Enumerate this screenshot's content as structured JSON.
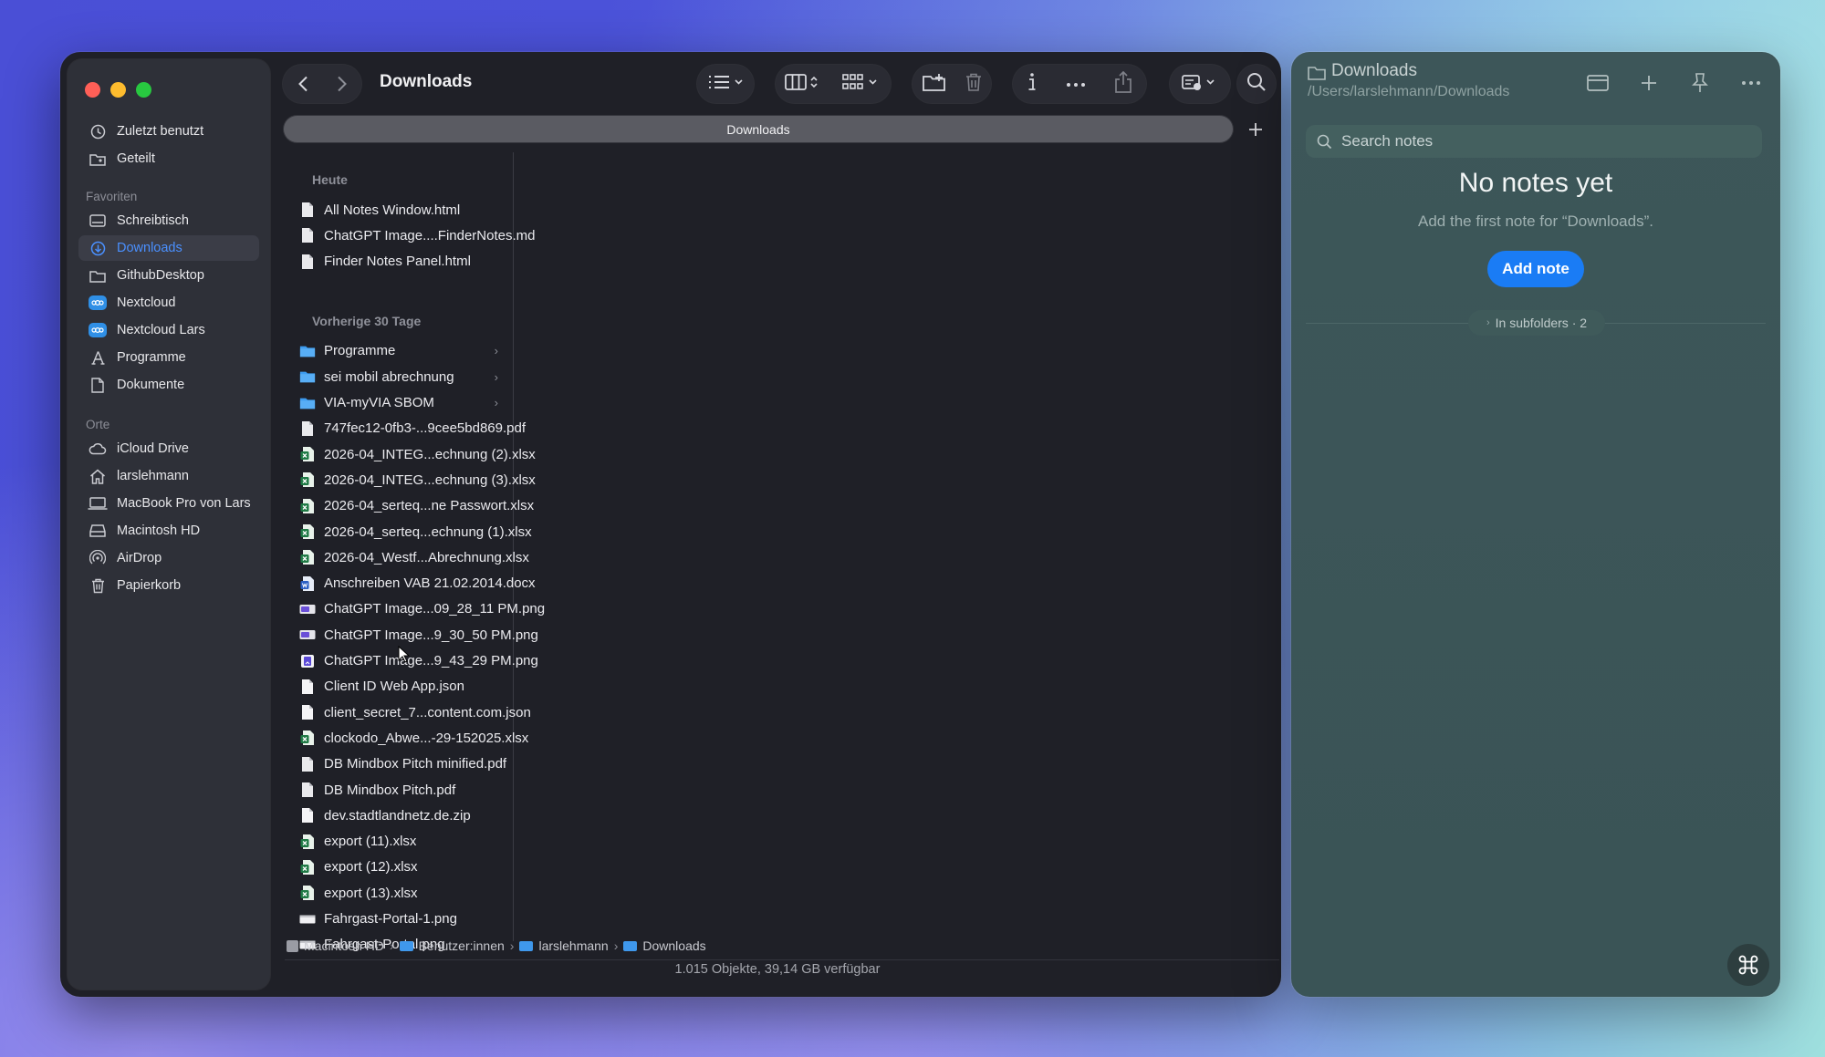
{
  "finder": {
    "title": "Downloads",
    "tab_label": "Downloads",
    "sidebar": {
      "recents": [
        {
          "label": "Zuletzt benutzt",
          "icon": "clock-icon"
        },
        {
          "label": "Geteilt",
          "icon": "shared-folder-icon"
        }
      ],
      "favorites_header": "Favoriten",
      "favorites": [
        {
          "label": "Schreibtisch",
          "icon": "desktop-icon"
        },
        {
          "label": "Downloads",
          "icon": "download-icon",
          "active": true
        },
        {
          "label": "GithubDesktop",
          "icon": "folder-icon"
        },
        {
          "label": "Nextcloud",
          "icon": "nextcloud-icon"
        },
        {
          "label": "Nextcloud Lars",
          "icon": "nextcloud-icon"
        },
        {
          "label": "Programme",
          "icon": "applications-icon"
        },
        {
          "label": "Dokumente",
          "icon": "document-icon"
        }
      ],
      "places_header": "Orte",
      "places": [
        {
          "label": "iCloud Drive",
          "icon": "cloud-icon"
        },
        {
          "label": "larslehmann",
          "icon": "home-icon"
        },
        {
          "label": "MacBook Pro von Lars",
          "icon": "laptop-icon"
        },
        {
          "label": "Macintosh HD",
          "icon": "disk-icon"
        },
        {
          "label": "AirDrop",
          "icon": "airdrop-icon"
        },
        {
          "label": "Papierkorb",
          "icon": "trash-icon"
        }
      ]
    },
    "groups": [
      {
        "header": "Heute",
        "files": [
          {
            "name": "All Notes Window.html",
            "kind": "doc"
          },
          {
            "name": "ChatGPT Image....FinderNotes.md",
            "kind": "doc"
          },
          {
            "name": "Finder Notes Panel.html",
            "kind": "doc"
          }
        ]
      },
      {
        "header": "Vorherige 30 Tage",
        "files": [
          {
            "name": "Programme",
            "kind": "folder"
          },
          {
            "name": "sei mobil abrechnung",
            "kind": "folder"
          },
          {
            "name": "VIA-myVIA SBOM",
            "kind": "folder"
          },
          {
            "name": "747fec12-0fb3-...9cee5bd869.pdf",
            "kind": "doc"
          },
          {
            "name": "2026-04_INTEG...echnung (2).xlsx",
            "kind": "xlsx"
          },
          {
            "name": "2026-04_INTEG...echnung (3).xlsx",
            "kind": "xlsx"
          },
          {
            "name": "2026-04_serteq...ne Passwort.xlsx",
            "kind": "xlsx"
          },
          {
            "name": "2026-04_serteq...echnung (1).xlsx",
            "kind": "xlsx"
          },
          {
            "name": "2026-04_Westf...Abrechnung.xlsx",
            "kind": "xlsx"
          },
          {
            "name": "Anschreiben VAB 21.02.2014.docx",
            "kind": "docx"
          },
          {
            "name": "ChatGPT Image...09_28_11 PM.png",
            "kind": "png"
          },
          {
            "name": "ChatGPT Image...9_30_50 PM.png",
            "kind": "png"
          },
          {
            "name": "ChatGPT Image...9_43_29 PM.png",
            "kind": "png2"
          },
          {
            "name": "Client ID Web App.json",
            "kind": "blank"
          },
          {
            "name": "client_secret_7...content.com.json",
            "kind": "blank"
          },
          {
            "name": "clockodo_Abwe...-29-152025.xlsx",
            "kind": "xlsx"
          },
          {
            "name": "DB Mindbox Pitch minified.pdf",
            "kind": "doc"
          },
          {
            "name": "DB Mindbox Pitch.pdf",
            "kind": "doc"
          },
          {
            "name": "dev.stadtlandnetz.de.zip",
            "kind": "blank"
          },
          {
            "name": "export (11).xlsx",
            "kind": "xlsx"
          },
          {
            "name": "export (12).xlsx",
            "kind": "xlsx"
          },
          {
            "name": "export (13).xlsx",
            "kind": "xlsx"
          },
          {
            "name": "Fahrgast-Portal-1.png",
            "kind": "thumb"
          },
          {
            "name": "Fahrgast-Portal.png",
            "kind": "thumb"
          }
        ]
      }
    ],
    "breadcrumbs": [
      "Macintosh HD",
      "Benutzer:innen",
      "larslehmann",
      "Downloads"
    ],
    "status": "1.015 Objekte, 39,14 GB verfügbar"
  },
  "notes": {
    "folder_title": "Downloads",
    "folder_path": "/Users/larslehmann/Downloads",
    "search_placeholder": "Search notes",
    "empty_title": "No notes yet",
    "empty_subtitle": "Add the first note for “Downloads”.",
    "add_button": "Add note",
    "subfolders_chip": "In subfolders · 2"
  },
  "colors": {
    "accent": "#1a7cf5",
    "sidebar_active_text": "#4a90ff",
    "window_bg": "#1f2027",
    "notes_bg": "#3d5659"
  }
}
